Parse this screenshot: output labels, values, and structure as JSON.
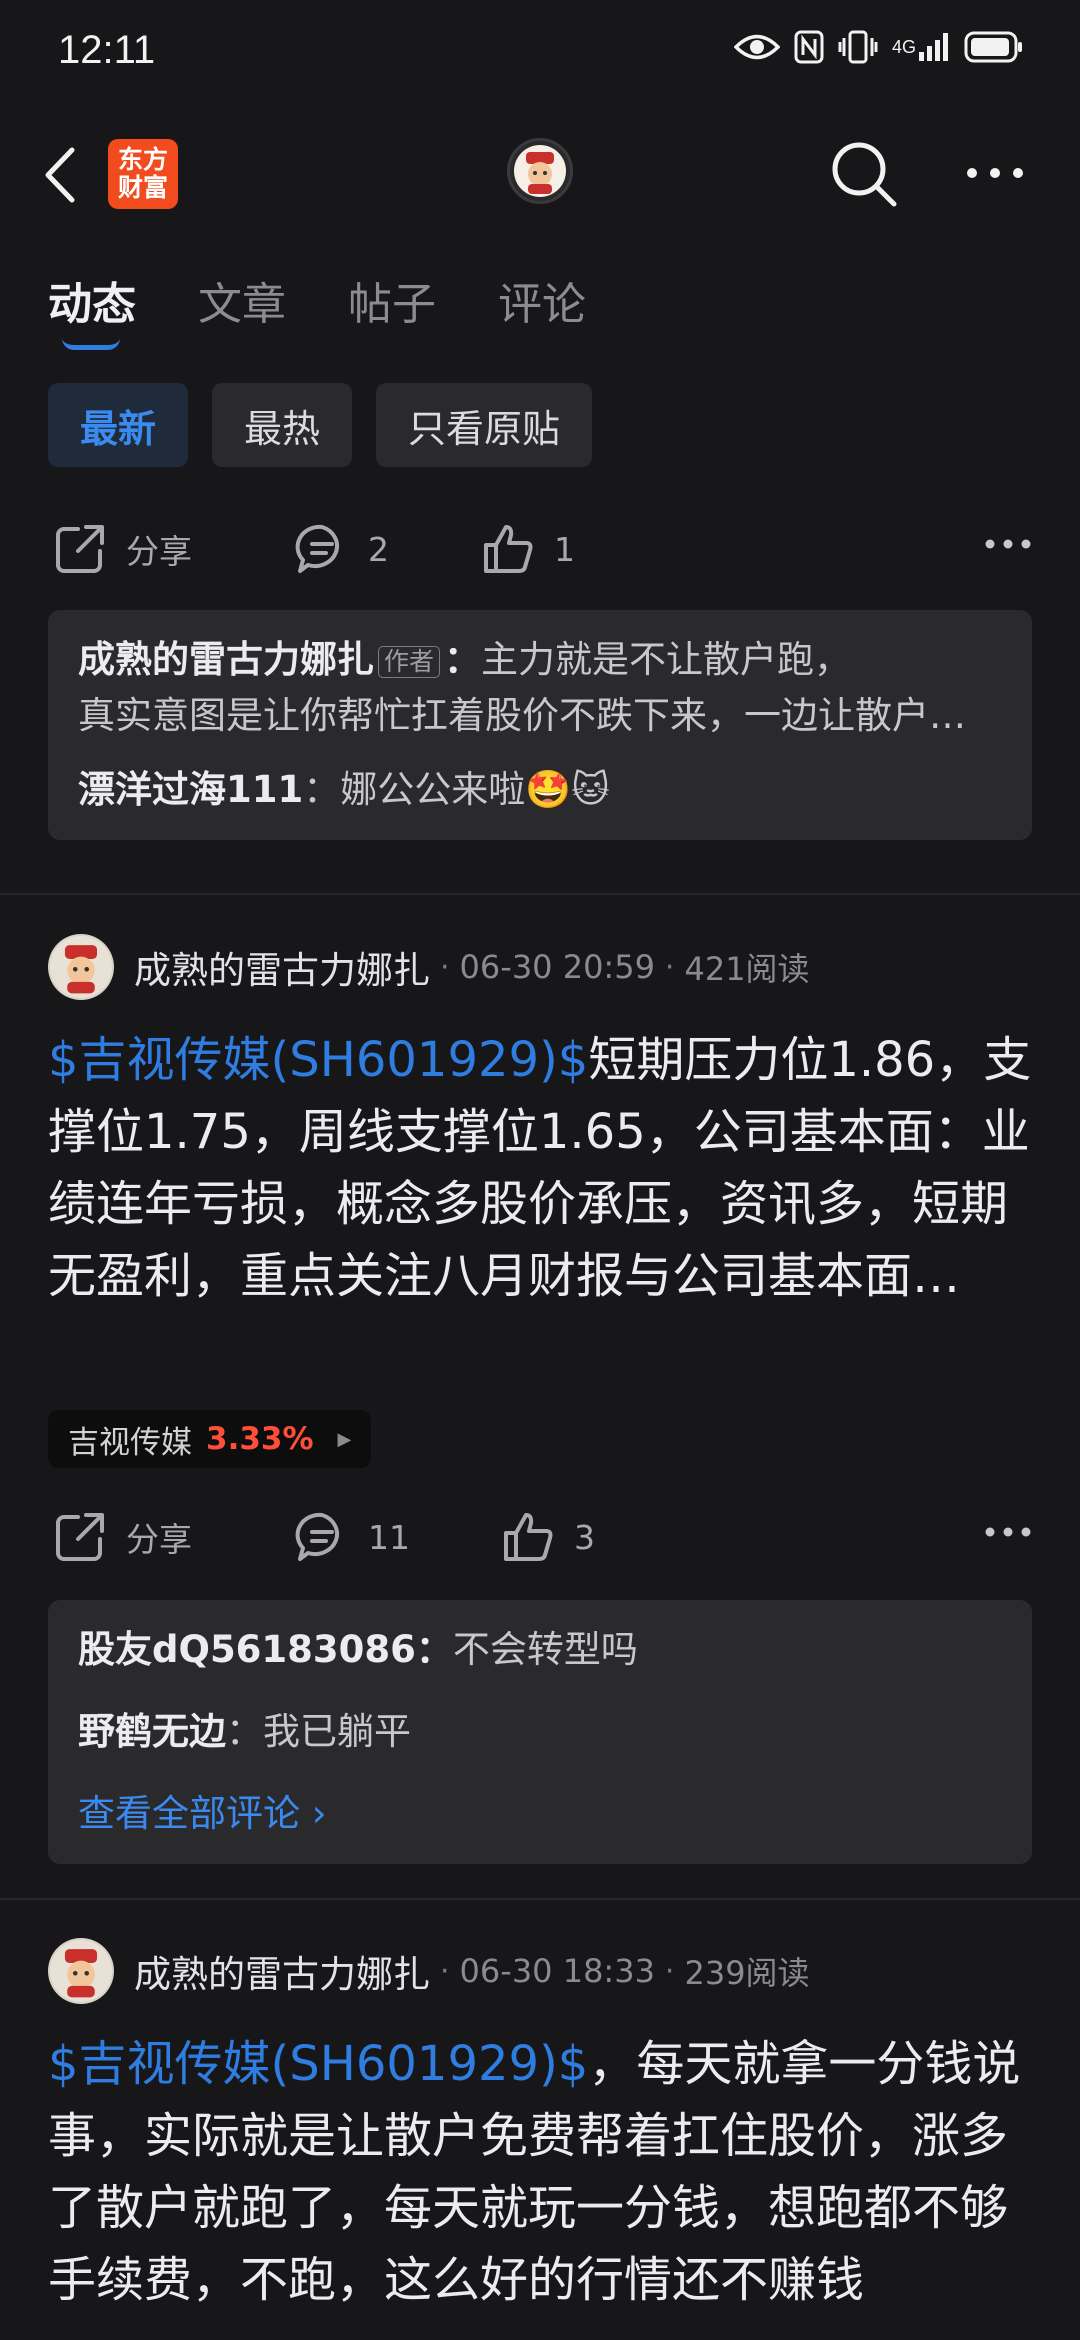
{
  "status_bar": {
    "time": "12:11",
    "network": "4G"
  },
  "header": {
    "app_logo_line1": "东方",
    "app_logo_line2": "财富"
  },
  "tabs": [
    "动态",
    "文章",
    "帖子",
    "评论"
  ],
  "filters": [
    "最新",
    "最热",
    "只看原贴"
  ],
  "action_labels": {
    "share": "分享"
  },
  "top_block": {
    "comment_count": "2",
    "like_count": "1",
    "comments": [
      {
        "name": "成熟的雷古力娜扎",
        "tag": "作者",
        "sep": "：",
        "text": "主力就是不让散户跑，"
      },
      {
        "name": "",
        "tag": "",
        "sep": "",
        "text": "真实意图是让你帮忙扛着股价不跌下来，一边让散户接盘一边出货"
      },
      {
        "name": "漂洋过海111",
        "tag": "",
        "sep": "：",
        "text": "娜公公来啦🤩🐱"
      }
    ]
  },
  "posts": [
    {
      "author": "成熟的雷古力娜扎",
      "time": "06-30 20:59",
      "reads": "421阅读",
      "stock_tag": "$吉视传媒(SH601929)$",
      "body": "短期压力位1.86，支撑位1.75，周线支撑位1.65，公司基本面：业绩连年亏损，概念多股价承压，资讯多，短期无盈利，重点关注八月财报与公司基本面…",
      "stock_chip": {
        "name": "吉视传媒",
        "change": "3.33%"
      },
      "comment_count": "11",
      "like_count": "3",
      "comments": [
        {
          "name": "股友dQ56183086",
          "sep": "：",
          "text": "不会转型吗"
        },
        {
          "name": "野鹤无边",
          "sep": "：",
          "text": "我已躺平"
        }
      ],
      "see_all": "查看全部评论 ›"
    },
    {
      "author": "成熟的雷古力娜扎",
      "time": "06-30 18:33",
      "reads": "239阅读",
      "stock_tag": "$吉视传媒(SH601929)$",
      "body": "，每天就拿一分钱说事，实际就是让散户免费帮着扛住股价，涨多了散户就跑了，每天就玩一分钱，想跑都不够手续费，不跑，这么好的行情还不赚钱"
    }
  ],
  "colors": {
    "accent": "#2f7de1",
    "up": "#ff4f3a",
    "logo": "#f24b1e",
    "background": "#171719"
  }
}
